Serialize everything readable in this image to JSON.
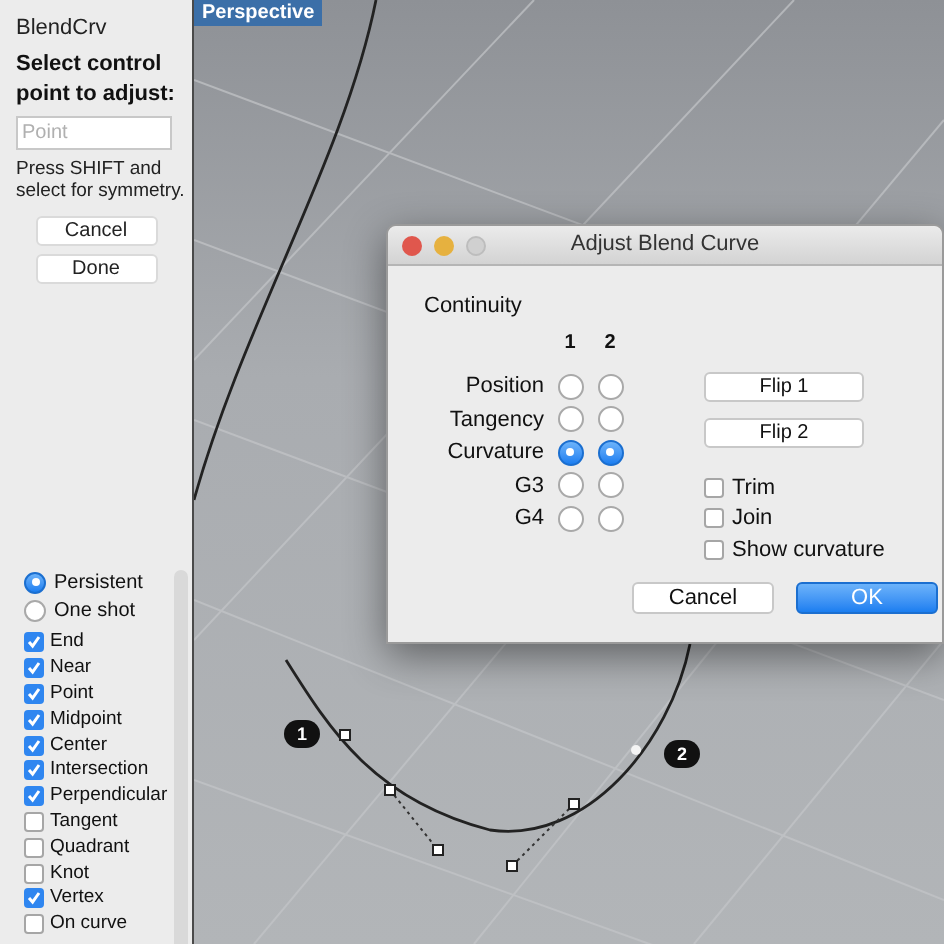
{
  "panel": {
    "title": "BlendCrv",
    "prompt": "Select control point to adjust:",
    "field": {
      "placeholder": "Point"
    },
    "hint": "Press SHIFT and select for symmetry.",
    "buttons": [
      "Cancel",
      "Done"
    ]
  },
  "snap_mode": [
    {
      "label": "Persistent",
      "selected": true
    },
    {
      "label": "One shot",
      "selected": false
    }
  ],
  "osnaps": [
    {
      "label": "End",
      "checked": true
    },
    {
      "label": "Near",
      "checked": true
    },
    {
      "label": "Point",
      "checked": true
    },
    {
      "label": "Midpoint",
      "checked": true
    },
    {
      "label": "Center",
      "checked": true
    },
    {
      "label": "Intersection",
      "checked": true
    },
    {
      "label": "Perpendicular",
      "checked": true
    },
    {
      "label": "Tangent",
      "checked": false
    },
    {
      "label": "Quadrant",
      "checked": false
    },
    {
      "label": "Knot",
      "checked": false
    },
    {
      "label": "Vertex",
      "checked": true
    },
    {
      "label": "On curve",
      "checked": false
    }
  ],
  "viewport": {
    "label": "Perspective",
    "markers": [
      "1",
      "2"
    ]
  },
  "dialog": {
    "title": "Adjust Blend Curve",
    "section": "Continuity",
    "columns": [
      "1",
      "2"
    ],
    "rows": [
      {
        "label": "Position",
        "cells": [
          {
            "selected": false
          },
          {
            "selected": false
          }
        ]
      },
      {
        "label": "Tangency",
        "cells": [
          {
            "selected": false
          },
          {
            "selected": false
          }
        ]
      },
      {
        "label": "Curvature",
        "cells": [
          {
            "selected": true
          },
          {
            "selected": true
          }
        ]
      },
      {
        "label": "G3",
        "cells": [
          {
            "selected": false
          },
          {
            "selected": false
          }
        ]
      },
      {
        "label": "G4",
        "cells": [
          {
            "selected": false
          },
          {
            "selected": false
          }
        ]
      }
    ],
    "flip_buttons": [
      "Flip 1",
      "Flip 2"
    ],
    "options": [
      {
        "label": "Trim",
        "checked": false
      },
      {
        "label": "Join",
        "checked": false
      },
      {
        "label": "Show curvature",
        "checked": false
      }
    ],
    "buttons": [
      {
        "label": "Cancel",
        "default": false
      },
      {
        "label": "OK",
        "default": true
      }
    ]
  }
}
